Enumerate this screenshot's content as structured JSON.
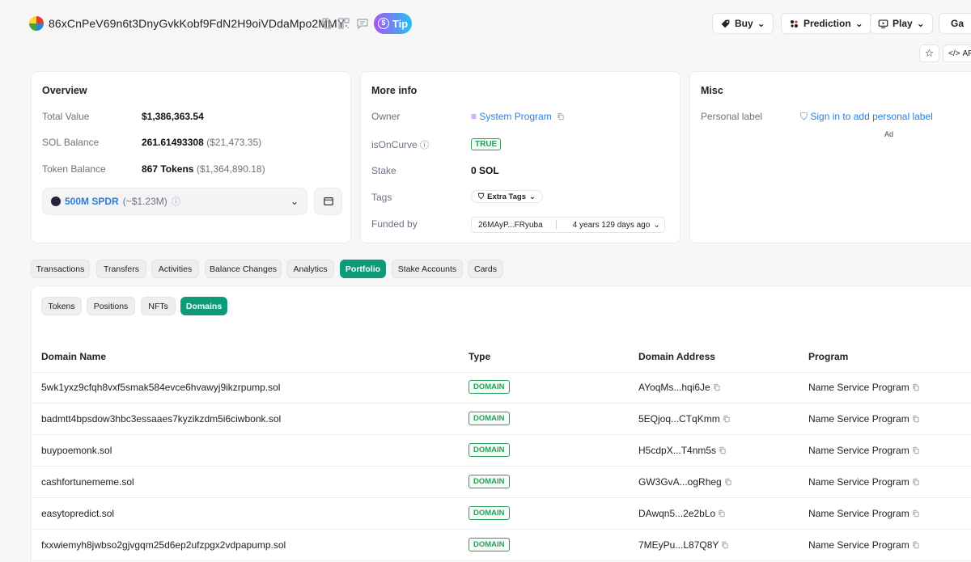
{
  "header": {
    "address": "86xCnPeV69n6t3DnyGvkKobf9FdN2H9oiVDdaMpo2MMY",
    "tip_label": "Tip",
    "nav": [
      {
        "label": "Buy",
        "icon": "tag-icon"
      },
      {
        "label": "Prediction",
        "icon": "dots-icon"
      },
      {
        "label": "Play",
        "icon": "monitor-icon"
      },
      {
        "label": "Ga",
        "icon": "gamepad-icon"
      }
    ],
    "api_label": "API"
  },
  "overview": {
    "title": "Overview",
    "rows": [
      {
        "label": "Total Value",
        "value": "$1,386,363.54",
        "sub": ""
      },
      {
        "label": "SOL Balance",
        "value": "261.61493308",
        "sub": "($21,473.35)"
      },
      {
        "label": "Token Balance",
        "value": "867 Tokens",
        "sub": "($1,364,890.18)"
      }
    ],
    "token_select": {
      "name": "500M SPDR",
      "sub": "(~$1.23M)"
    }
  },
  "more_info": {
    "title": "More info",
    "owner_label": "Owner",
    "owner_value": "System Program",
    "oncurve_label": "isOnCurve",
    "oncurve_value": "TRUE",
    "stake_label": "Stake",
    "stake_value": "0 SOL",
    "tags_label": "Tags",
    "tags_value": "Extra Tags",
    "funded_label": "Funded by",
    "funded_address": "26MAyP...FRyuba",
    "funded_time": "4 years 129 days ago"
  },
  "misc": {
    "title": "Misc",
    "personal_label": "Personal label",
    "sign_in_link": "Sign in to add personal label",
    "ad_label": "Ad"
  },
  "tabs": [
    "Transactions",
    "Transfers",
    "Activities",
    "Balance Changes",
    "Analytics",
    "Portfolio",
    "Stake Accounts",
    "Cards"
  ],
  "active_tab": "Portfolio",
  "subtabs": [
    "Tokens",
    "Positions",
    "NFTs",
    "Domains"
  ],
  "active_subtab": "Domains",
  "table": {
    "columns": [
      "Domain Name",
      "Type",
      "Domain Address",
      "Program"
    ],
    "rows": [
      {
        "name": "5wk1yxz9cfqh8vxf5smak584evce6hvawyj9ikzrpump.sol",
        "type": "DOMAIN",
        "address": "AYoqMs...hqi6Je",
        "program": "Name Service Program"
      },
      {
        "name": "badmtt4bpsdow3hbc3essaaes7kyzikzdm5i6ciwbonk.sol",
        "type": "DOMAIN",
        "address": "5EQjoq...CTqKmm",
        "program": "Name Service Program"
      },
      {
        "name": "buypoemonk.sol",
        "type": "DOMAIN",
        "address": "H5cdpX...T4nm5s",
        "program": "Name Service Program"
      },
      {
        "name": "cashfortunememe.sol",
        "type": "DOMAIN",
        "address": "GW3GvA...ogRheg",
        "program": "Name Service Program"
      },
      {
        "name": "easytopredict.sol",
        "type": "DOMAIN",
        "address": "DAwqn5...2e2bLo",
        "program": "Name Service Program"
      },
      {
        "name": "fxxwiemyh8jwbso2gjvgqm25d6ep2ufzpgx2vdpapump.sol",
        "type": "DOMAIN",
        "address": "7MEyPu...L87Q8Y",
        "program": "Name Service Program"
      }
    ]
  },
  "colors": {
    "accent": "#0f9a7a",
    "link": "#2a7fdd",
    "success": "#2e9d5b"
  }
}
